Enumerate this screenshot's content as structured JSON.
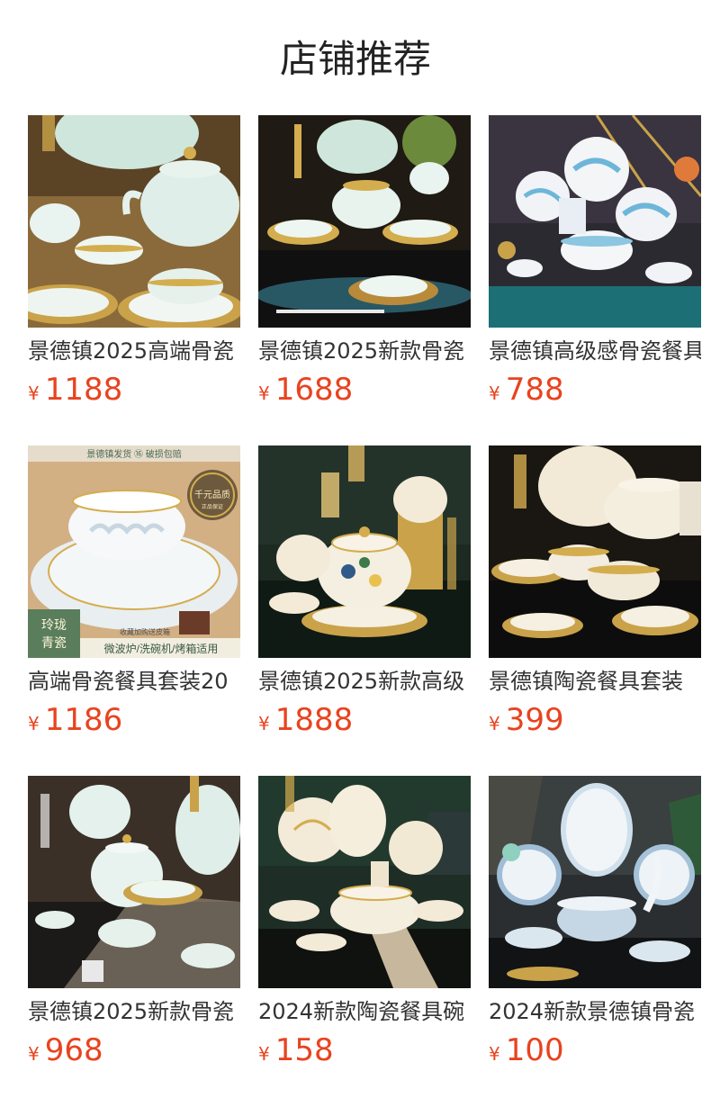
{
  "header": {
    "title": "店铺推荐"
  },
  "colors": {
    "price": "#e8431f",
    "title": "#222222",
    "name": "#333333"
  },
  "products": [
    {
      "name": "景德镇2025高端骨瓷",
      "currency": "¥",
      "price": "1188",
      "image": "bone-china-set-mint-teapot"
    },
    {
      "name": "景德镇2025新款骨瓷",
      "currency": "¥",
      "price": "1688",
      "image": "bone-china-set-dark-table"
    },
    {
      "name": "景德镇高级感骨瓷餐具",
      "currency": "¥",
      "price": "788",
      "image": "blue-landscape-ceramic-set"
    },
    {
      "name": "高端骨瓷餐具套装20",
      "currency": "¥",
      "price": "1186",
      "image": "linglong-celadon-bowl-ad",
      "ad": {
        "banner": "景德镇发货 ⑯ 破损包赔",
        "seal": "千元品质",
        "seal_sub": "正品保证",
        "corner": "玲珑\n青瓷",
        "footer": "微波炉/洗碗机/烤箱适用",
        "gift": "收藏加购送皮箱"
      }
    },
    {
      "name": "景德镇2025新款高级",
      "currency": "¥",
      "price": "1888",
      "image": "floral-gold-rim-set"
    },
    {
      "name": "景德镇陶瓷餐具套装",
      "currency": "¥",
      "price": "399",
      "image": "cream-beaded-rim-set"
    },
    {
      "name": "景德镇2025新款骨瓷",
      "currency": "¥",
      "price": "968",
      "image": "mint-teapot-table-runner"
    },
    {
      "name": "2024新款陶瓷餐具碗",
      "currency": "¥",
      "price": "158",
      "image": "gold-leaf-ceramic-set"
    },
    {
      "name": "2024新款景德镇骨瓷",
      "currency": "¥",
      "price": "100",
      "image": "blue-gradient-swan-set"
    }
  ]
}
